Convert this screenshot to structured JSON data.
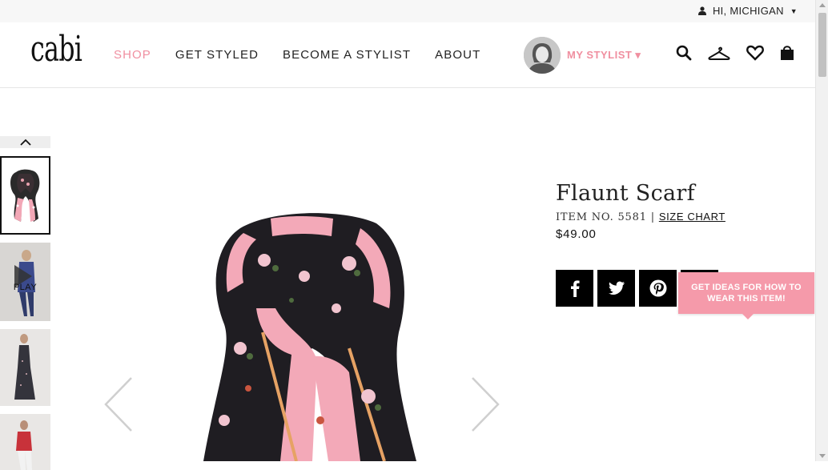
{
  "topbar": {
    "greeting": "HI, MICHIGAN"
  },
  "header": {
    "logo": "cabi",
    "nav": [
      {
        "label": "SHOP",
        "active": true
      },
      {
        "label": "GET STYLED"
      },
      {
        "label": "BECOME A STYLIST"
      },
      {
        "label": "ABOUT"
      }
    ],
    "stylist_label": "MY STYLIST ▾",
    "icons": [
      "search-icon",
      "hanger-icon",
      "heart-icon",
      "shopping-bag-icon"
    ]
  },
  "gallery": {
    "thumbnails": [
      "scarf-thumbnail",
      "video-thumbnail",
      "model-dress-thumbnail",
      "model-red-top-thumbnail"
    ],
    "play_label": "PLAY"
  },
  "product": {
    "title": "Flaunt Scarf",
    "item_no": "ITEM NO. 5581",
    "separator": "|",
    "size_chart": "SIZE CHART",
    "price": "$49.00"
  },
  "social": {
    "buttons": [
      "facebook-icon",
      "twitter-icon",
      "pinterest-icon"
    ]
  },
  "tooltip": {
    "text": "GET IDEAS FOR HOW TO WEAR THIS ITEM!"
  },
  "colors": {
    "accent": "#f08fa0",
    "tooltip_bg": "#f59aaa",
    "text": "#222222"
  }
}
